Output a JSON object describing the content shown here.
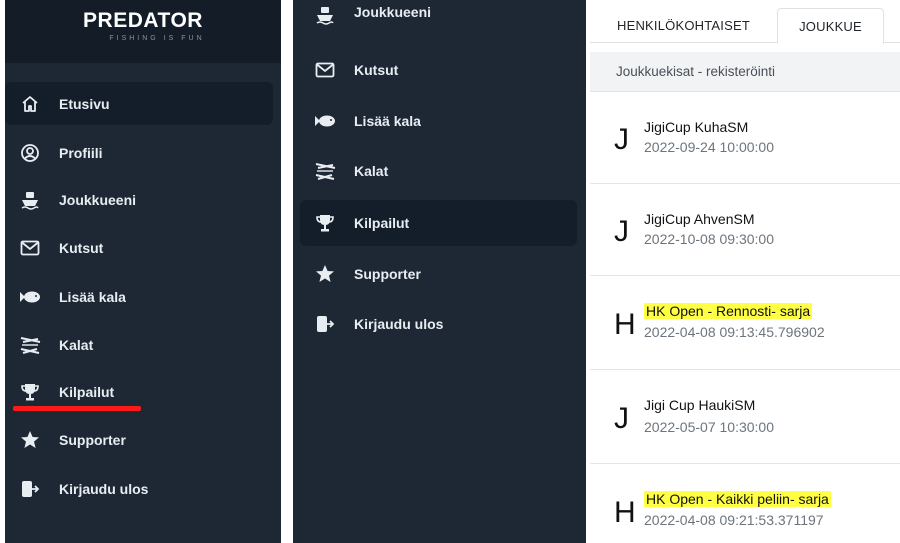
{
  "app": {
    "logo_text": "PREDATOR",
    "logo_tagline": "FISHING IS FUN"
  },
  "left_nav": {
    "items": [
      {
        "label": "Etusivu",
        "icon": "home-icon"
      },
      {
        "label": "Profiili",
        "icon": "user-circle-icon"
      },
      {
        "label": "Joukkueeni",
        "icon": "boat-icon"
      },
      {
        "label": "Kutsut",
        "icon": "envelope-icon"
      },
      {
        "label": "Lisää kala",
        "icon": "fish-icon"
      },
      {
        "label": "Kalat",
        "icon": "fishes-icon"
      },
      {
        "label": "Kilpailut",
        "icon": "trophy-icon"
      },
      {
        "label": "Supporter",
        "icon": "star-icon"
      },
      {
        "label": "Kirjaudu ulos",
        "icon": "logout-icon"
      }
    ],
    "active_item": "Etusivu",
    "annotation_underline_color": "#ff1a1a"
  },
  "middle_nav": {
    "items": [
      {
        "label": "Joukkueeni",
        "icon": "boat-icon"
      },
      {
        "label": "Kutsut",
        "icon": "envelope-icon"
      },
      {
        "label": "Lisää kala",
        "icon": "fish-icon"
      },
      {
        "label": "Kalat",
        "icon": "fishes-icon"
      },
      {
        "label": "Kilpailut",
        "icon": "trophy-icon"
      },
      {
        "label": "Supporter",
        "icon": "star-icon"
      },
      {
        "label": "Kirjaudu ulos",
        "icon": "logout-icon"
      }
    ],
    "active_item": "Kilpailut"
  },
  "right_panel": {
    "tabs": [
      {
        "label": "HENKILÖKOHTAISET",
        "active": false
      },
      {
        "label": "JOUKKUE",
        "active": true
      }
    ],
    "section_title": "Joukkuekisat - rekisteröinti",
    "competitions": [
      {
        "initial": "J",
        "name": "JigiCup KuhaSM",
        "datetime": "2022-09-24 10:00:00",
        "highlighted": false
      },
      {
        "initial": "J",
        "name": "JigiCup AhvenSM",
        "datetime": "2022-10-08 09:30:00",
        "highlighted": false
      },
      {
        "initial": "H",
        "name": "HK Open - Rennosti- sarja",
        "datetime": "2022-04-08 09:13:45.796902",
        "highlighted": true
      },
      {
        "initial": "J",
        "name": "Jigi Cup HaukiSM",
        "datetime": "2022-05-07 10:30:00",
        "highlighted": false
      },
      {
        "initial": "H",
        "name": "HK Open - Kaikki peliin- sarja",
        "datetime": "2022-04-08 09:21:53.371197",
        "highlighted": true
      }
    ],
    "highlight_color": "#ffff44"
  },
  "colors": {
    "sidebar_bg": "#1e2834",
    "sidebar_active_bg": "#141e2a",
    "sidebar_text": "#e8edf2"
  }
}
